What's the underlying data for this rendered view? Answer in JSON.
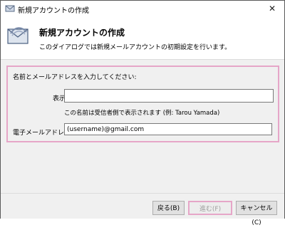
{
  "window": {
    "title": "新規アカウントの作成",
    "close_glyph": "✕"
  },
  "header": {
    "title": "新規アカウントの作成",
    "subtitle": "このダイアログでは新規メールアカウントの初期設定を行います。"
  },
  "form": {
    "instruction": "名前とメールアドレスを入力してください:",
    "display_name_label": "表示名:",
    "display_name_value": "",
    "display_name_hint": "この名前は受信者側で表示されます (例: Tarou Yamada)",
    "email_label": "電子メールアドレス:",
    "email_value": "(username)@gmail.com"
  },
  "buttons": {
    "back": "戻る(B)",
    "next": "進む(F)",
    "cancel": "キャンセル(C)"
  },
  "colors": {
    "highlight": "#e6a6c8",
    "dialog_body": "#f0f0f0"
  },
  "icons": [
    "app-envelope-icon",
    "wizard-envelope-icon",
    "close-icon"
  ]
}
